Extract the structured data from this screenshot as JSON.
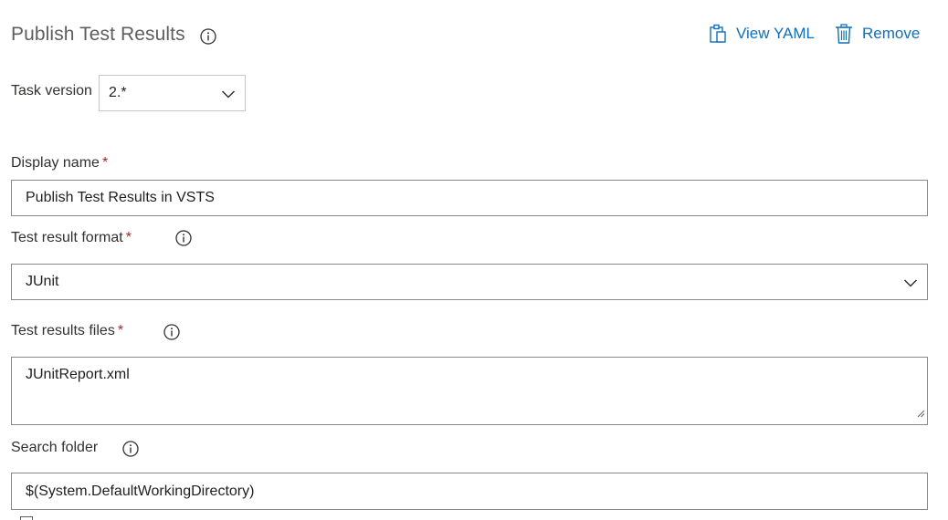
{
  "header": {
    "title": "Publish Test Results",
    "view_yaml_label": "View YAML",
    "remove_label": "Remove"
  },
  "task_version": {
    "label": "Task version",
    "value": "2.*"
  },
  "display_name": {
    "label": "Display name",
    "required_mark": "*",
    "value": "Publish Test Results in VSTS"
  },
  "test_result_format": {
    "label": "Test result format",
    "required_mark": "*",
    "value": "JUnit"
  },
  "test_results_files": {
    "label": "Test results files",
    "required_mark": "*",
    "value": "JUnitReport.xml"
  },
  "search_folder": {
    "label": "Search folder",
    "value": "$(System.DefaultWorkingDirectory)"
  },
  "colors": {
    "accent": "#106ebe",
    "required": "#a4262c",
    "border": "#8a8886"
  },
  "icons": [
    "info-icon",
    "clipboard-icon",
    "trash-icon",
    "chevron-down-icon",
    "resize-grip-icon"
  ]
}
